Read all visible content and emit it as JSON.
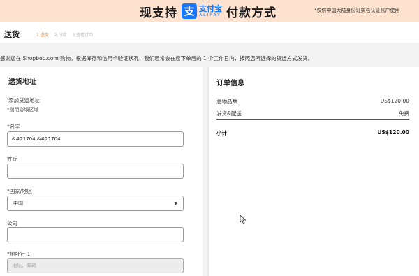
{
  "banner": {
    "prefix": "现支持",
    "alipay_glyph": "支",
    "alipay_cn": "支付宝",
    "alipay_en": "ALIPAY",
    "suffix": "付款方式",
    "note": "*仅供中国大陆身份证实名认证账户使用",
    "bg_color": "#fde2cf",
    "brand_color": "#1678ff"
  },
  "header": {
    "title": "送货",
    "steps": [
      "1.送货",
      "2.付款",
      "3.查看订单"
    ],
    "active_color": "#e8893b"
  },
  "notice": "感谢您在 Shopbop.com 购物。根据库存和信用卡验证状况，我们通常会在您下单后的 1 个工作日内，按照您所选择的货运方式发货。",
  "shipping_form": {
    "title": "送货地址",
    "add_address": "添加货运地址",
    "required_note": "*指明必填区域",
    "first_name": {
      "label": "*名字",
      "value": "&#21704;&#21704;"
    },
    "last_name": {
      "label": "姓氏",
      "value": ""
    },
    "country": {
      "label": "*国家/地区",
      "value": "中国"
    },
    "company": {
      "label": "公司",
      "value": ""
    },
    "address1": {
      "label": "*地址行 1",
      "placeholder": "地址、邮箱"
    }
  },
  "order_summary": {
    "title": "订单信息",
    "rows": [
      {
        "label": "总物品数",
        "value": "US$120.00"
      },
      {
        "label": "发货&配送",
        "value": "免费"
      }
    ],
    "total": {
      "label": "小计",
      "value": "US$120.00"
    }
  }
}
